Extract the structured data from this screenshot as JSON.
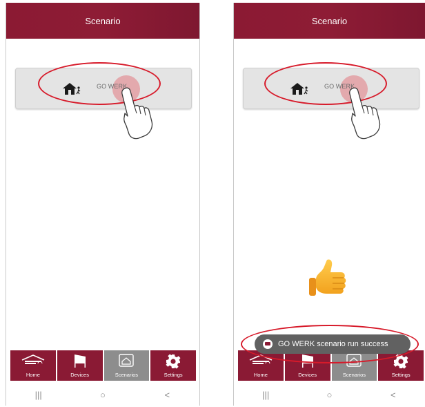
{
  "screens": [
    {
      "title": "Scenario",
      "scenario": {
        "label": "GO WERK",
        "icon": "house-person-icon"
      },
      "tabs": [
        {
          "label": "Home",
          "icon": "home-icon",
          "active": false
        },
        {
          "label": "Devices",
          "icon": "devices-icon",
          "active": false
        },
        {
          "label": "Scenarios",
          "icon": "scenarios-icon",
          "active": true
        },
        {
          "label": "Settings",
          "icon": "gear-icon",
          "active": false
        }
      ],
      "navbar": {
        "recents": "|||",
        "home": "○",
        "back": "<"
      }
    },
    {
      "title": "Scenario",
      "scenario": {
        "label": "GO WERK",
        "icon": "house-person-icon"
      },
      "tabs": [
        {
          "label": "Home",
          "icon": "home-icon",
          "active": false
        },
        {
          "label": "Devices",
          "icon": "devices-icon",
          "active": false
        },
        {
          "label": "Scenarios",
          "icon": "scenarios-icon",
          "active": true
        },
        {
          "label": "Settings",
          "icon": "gear-icon",
          "active": false
        }
      ],
      "toast": "GO WERK scenario run success",
      "navbar": {
        "recents": "|||",
        "home": "○",
        "back": "<"
      }
    }
  ],
  "colors": {
    "brand": "#8a1a34",
    "active_tab": "#8d8d8d",
    "highlight": "#d71a2a",
    "toast_bg": "#616161"
  }
}
